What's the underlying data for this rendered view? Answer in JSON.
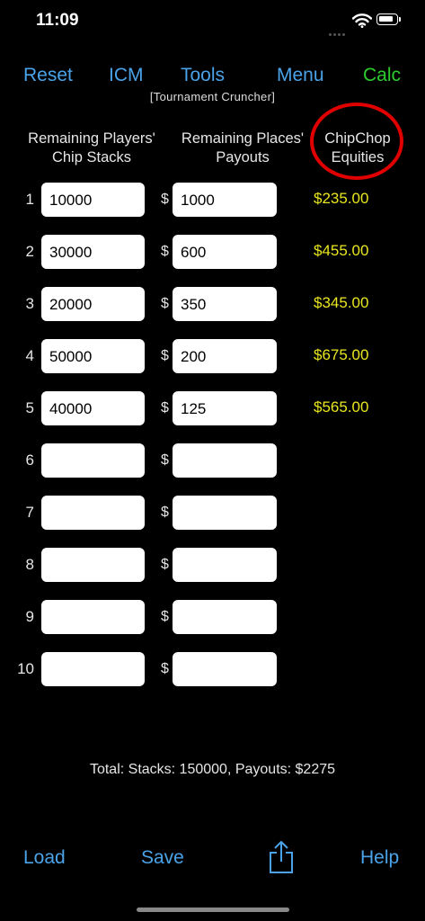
{
  "status": {
    "time": "11:09"
  },
  "nav": {
    "reset": "Reset",
    "icm": "ICM",
    "tools": "Tools",
    "menu": "Menu",
    "calc": "Calc"
  },
  "subtitle": "[Tournament Cruncher]",
  "headers": {
    "stacks_line1": "Remaining Players'",
    "stacks_line2": "Chip Stacks",
    "payouts_line1": "Remaining Places'",
    "payouts_line2": "Payouts",
    "equities_line1": "ChipChop",
    "equities_line2": "Equities"
  },
  "currency_symbol": "$",
  "rows": [
    {
      "num": "1",
      "stack": "10000",
      "payout": "1000",
      "equity": "$235.00"
    },
    {
      "num": "2",
      "stack": "30000",
      "payout": "600",
      "equity": "$455.00"
    },
    {
      "num": "3",
      "stack": "20000",
      "payout": "350",
      "equity": "$345.00"
    },
    {
      "num": "4",
      "stack": "50000",
      "payout": "200",
      "equity": "$675.00"
    },
    {
      "num": "5",
      "stack": "40000",
      "payout": "125",
      "equity": "$565.00"
    },
    {
      "num": "6",
      "stack": "",
      "payout": "",
      "equity": ""
    },
    {
      "num": "7",
      "stack": "",
      "payout": "",
      "equity": ""
    },
    {
      "num": "8",
      "stack": "",
      "payout": "",
      "equity": ""
    },
    {
      "num": "9",
      "stack": "",
      "payout": "",
      "equity": ""
    },
    {
      "num": "10",
      "stack": "",
      "payout": "",
      "equity": ""
    }
  ],
  "totals": "Total: Stacks: 150000, Payouts: $2275",
  "bottom": {
    "load": "Load",
    "save": "Save",
    "help": "Help",
    "share_icon": "share-icon"
  },
  "colors": {
    "link": "#4aa3e8",
    "calc": "#2ecc2e",
    "equity": "#e8e620",
    "highlight_circle": "#e00000"
  }
}
